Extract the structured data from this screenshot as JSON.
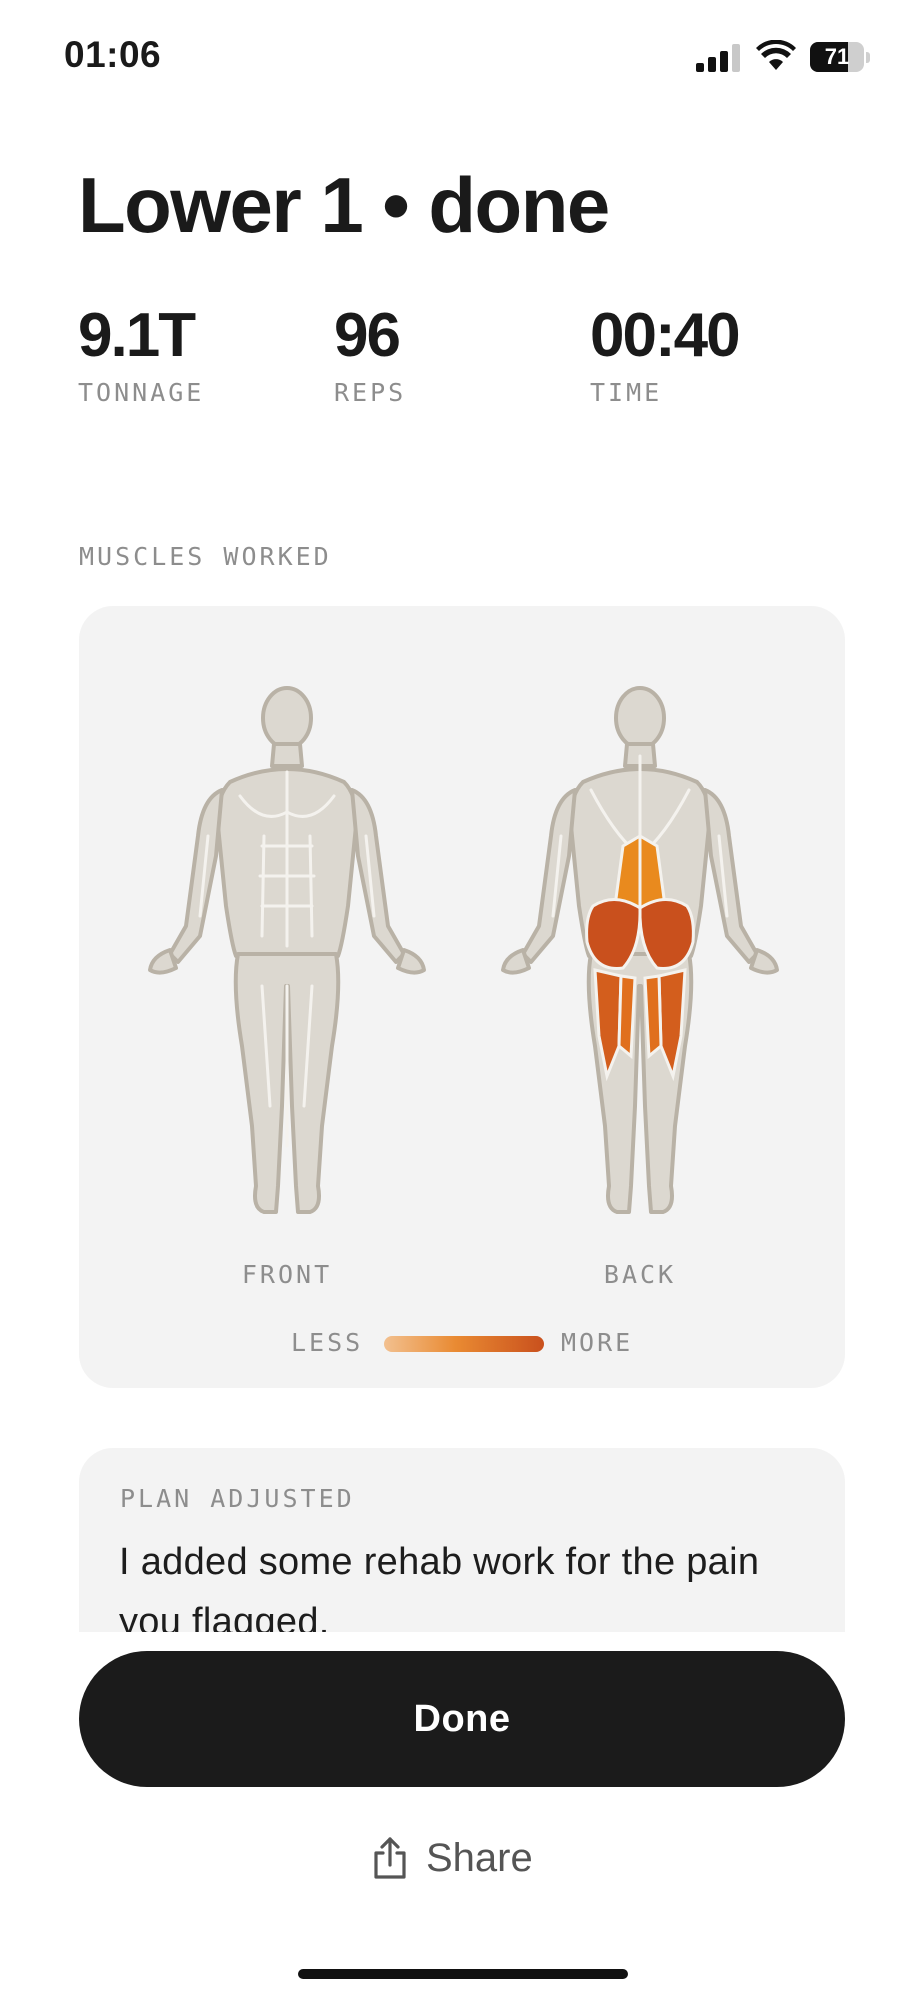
{
  "status_bar": {
    "time": "01:06",
    "battery_level": "71",
    "signal_bars": 3,
    "icons": [
      "cellular-signal-icon",
      "wifi-icon",
      "battery-icon"
    ]
  },
  "title": "Lower 1 • done",
  "stats": [
    {
      "value": "9.1T",
      "label": "TONNAGE"
    },
    {
      "value": "96",
      "label": "REPS"
    },
    {
      "value": "00:40",
      "label": "TIME"
    }
  ],
  "muscles": {
    "section_label": "MUSCLES WORKED",
    "front_label": "FRONT",
    "back_label": "BACK",
    "legend_less": "LESS",
    "legend_more": "MORE",
    "highlighted_back": [
      "lower-back",
      "glutes",
      "hamstrings"
    ],
    "colors": {
      "body": "#dcd8d0",
      "outline": "#b9b2a6",
      "high": "#c9501d",
      "mid": "#e98a1e"
    }
  },
  "plan": {
    "label": "PLAN ADJUSTED",
    "text": "I added some rehab work for the pain you flagged."
  },
  "actions": {
    "done_label": "Done",
    "share_label": "Share"
  }
}
